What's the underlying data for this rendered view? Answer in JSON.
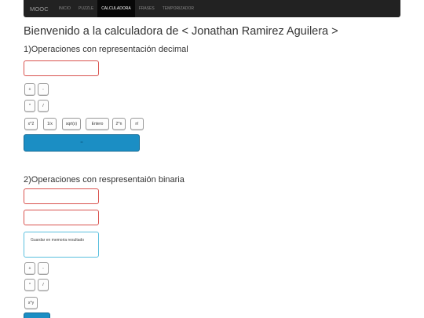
{
  "navbar": {
    "brand": "MOOC",
    "items": [
      "INICIO",
      "PUZZLE",
      "CALCULADORA",
      "FRASES",
      "TEMPORIZADOR"
    ],
    "active": "CALCULADORA"
  },
  "page": {
    "title": "Bienvenido a la calculadora de < Jonathan Ramirez Aguilera >"
  },
  "decimal": {
    "title": "1)Operaciones con representación decimal",
    "input_value": "",
    "buttons": {
      "plus": "+",
      "minus": "-",
      "times": "*",
      "divide": "/",
      "square": "x^2",
      "inverse": "1/x",
      "sqrt": "sqrt(x)",
      "integer": "Entero",
      "pow2": "2^n",
      "factorial": "n!",
      "equals": "="
    }
  },
  "binary": {
    "title": "2)Operaciones con respresentaión binaria",
    "input1_value": "",
    "input2_value": "",
    "memory_label": "Guardar en memoria resultado",
    "buttons": {
      "plus": "+",
      "minus": "-",
      "times": "*",
      "divide": "/",
      "power": "x^y"
    }
  },
  "colors": {
    "navbar_bg": "#222222",
    "primary": "#1b8ec4",
    "invalid_border": "#d9534f",
    "info_border": "#5bc0de"
  }
}
